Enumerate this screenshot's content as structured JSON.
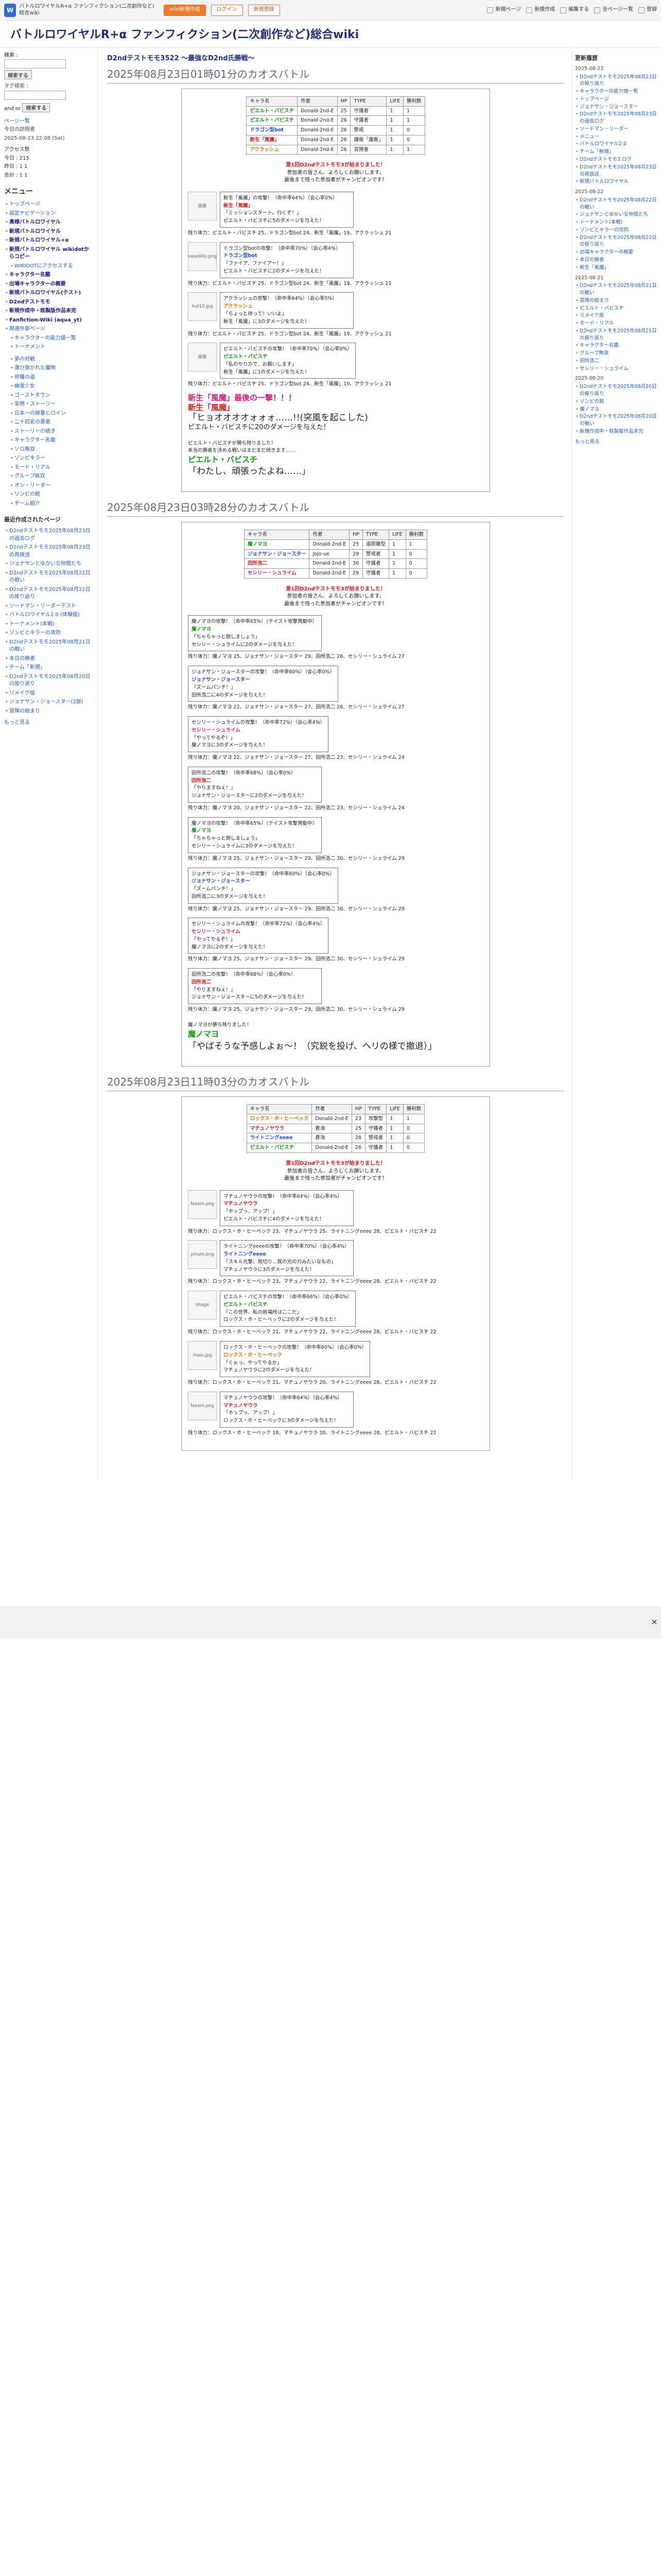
{
  "topbar": {
    "logo_text": "バトルロワイヤルR+α ファンフィクション(二次創作など)総合wiki",
    "logo_letter": "W",
    "buttons": [
      "wiki新規作成",
      "ログイン",
      "新規登録"
    ],
    "links": [
      "新規ページ",
      "新規作成",
      "編集する",
      "全ページ一覧",
      "登録"
    ]
  },
  "header": {
    "title": "バトルロワイヤルR+α ファンフィクション(二次創作など)総合wiki"
  },
  "menubar": {
    "search_label": "検索 :",
    "search_button": "検索する",
    "search2_button": "検索する",
    "tag_label": "タグ検索 :",
    "and_or": "and or",
    "stats": [
      "ページ一覧",
      "今日の訪問者",
      "2025-08-23 22:08 (Sat)"
    ],
    "counts": [
      "アクセス数",
      "今日 : 215",
      "昨日 : 1 1",
      "合計 : 1 1"
    ],
    "menu_title": "メニュー",
    "items": [
      {
        "label": "トップページ",
        "cls": ""
      },
      {
        "label": "設定ナビゲーション",
        "cls": ""
      },
      {
        "label": "奥様バトルロワイヤル",
        "cls": "bold"
      },
      {
        "label": "新規バトルロワイヤル",
        "cls": "bold"
      },
      {
        "label": "新規バトルロワイヤル+α",
        "cls": "bold"
      },
      {
        "label": "新規バトルロワイヤル wikidotからコピー",
        "cls": "bold"
      },
      {
        "label": "WIKIDOTにアクセスする",
        "cls": "sub"
      },
      {
        "label": "キャラクター名鑑",
        "cls": "bold"
      },
      {
        "label": "出場キャラクターの概要",
        "cls": "bold"
      },
      {
        "label": "新規バトルロワイヤル(テスト)",
        "cls": "bold"
      },
      {
        "label": "D2ndテストモモ",
        "cls": "bold"
      },
      {
        "label": "新規作成中・既製版作品未完",
        "cls": "bold"
      },
      {
        "label": "Fanfiction-Wiki (aqua_yt)",
        "cls": "bold"
      },
      {
        "label": "関連外部ページ",
        "cls": ""
      },
      {
        "label": "キャラクターの能力値一覧",
        "cls": "sub"
      },
      {
        "label": "トーナメント",
        "cls": "sub"
      }
    ],
    "items2_title": "",
    "items2": [
      "夢の対戦",
      "選び抜かれた魔物",
      "修羅の道",
      "幽霊少女",
      "ゴーストタウン",
      "妄想・ストーリー",
      "日本一の極悪ヒロイン",
      "二十四名の勇者",
      "ストーリーの続き",
      "キャラクター名鑑",
      "ソロ無双",
      "ゾンビキラー",
      "モード・リアル",
      "グループ無双",
      "オン・リーダー",
      "ゾンビの館",
      "チーム紹介"
    ],
    "recent_title": "最近作成されたページ",
    "recent": [
      "D2ndテストモモ2025年08月23日の過去ログ",
      "D2ndテストモモ2025年08月23日の再放送",
      "ジョナサンとゆかいな仲間たち",
      "D2ndテストモモ2025年08月22日の戦い",
      "D2ndテストモモ2025年08月22日の振り返り",
      "ソードマン・リーダーテスト",
      "バトルロワイヤル2.0 (体験版)",
      "トーナメント(本戦)",
      "ゾンビとキラーの攻防",
      "D2ndテストモモ2025年08月21日の戦い",
      "本日の勝者",
      "チーム「新規」",
      "D2ndテストモモ2025年08月20日の振り返り",
      "リメイク版",
      "ジョナサン・ジョースター(2部)",
      "冒険の始まり"
    ],
    "more_link": "もっと見る"
  },
  "main": {
    "section_title": "D2ndテストモモ3522 ～最強なD2nd氏勝戦～",
    "chapters": [
      {
        "heading": "2025年08月23日01時01分のカオスバトル",
        "roster_headers": [
          "キャラ名",
          "作者",
          "HP",
          "TYPE",
          "LIFE",
          "勝利数"
        ],
        "roster": [
          [
            "ピエルト・バビスチ",
            "Donald-2nd-E",
            "25",
            "守護者",
            "1",
            "1"
          ],
          [
            "ピエルト・バビスチ",
            "Donald-2nd-E",
            "26",
            "守護者",
            "1",
            "1"
          ],
          [
            "ドラゴン型bot",
            "Donald-2nd-E",
            "26",
            "警戒",
            "1",
            "0"
          ],
          [
            "新生「風魔」",
            "Donald-2nd-E",
            "26",
            "護衛「護衛」",
            "1",
            "0"
          ],
          [
            "アクラッシュ",
            "Donald-2nd-E",
            "26",
            "冒険者",
            "1",
            "1"
          ]
        ],
        "intro": [
          "第1回D2ndテストモモ3が始まりました！",
          "参加者の皆さん、よろしくお願いします。",
          "最後まで残った参加者がチャンピオンです！"
        ],
        "status": "残り体力：ピエルト・バビスチ 25、ドラゴン型bot 24、新生「風魔」19、アクラッシュ 21",
        "events": [
          {
            "icon": "画像",
            "lines": [
              "新生「風魔」の攻撃！（命中率64%）（会心率0%）",
              "新生「風魔」",
              "「ミッションスタート。行くぞ！」",
              "ピエルト・バビスチに5のダメージを与えた！"
            ]
          },
          {
            "icon": "vaseikko.png",
            "lines": [
              "ドラゴン型botの攻撃！（命中率70%）（会心率4%）",
              "ドラゴン型bot",
              "「ファイア、ファイアー！」",
              "ピエルト・バビスチに2のダメージを与えた！"
            ]
          },
          {
            "icon": "hut10.jpg",
            "lines": [
              "アクラッシュの攻撃！（命中率64%）（会心率5%）",
              "アクラッシュ",
              "「ちょっと待って！いいよ」",
              "新生「風魔」に3のダメージを与えた！"
            ]
          },
          {
            "icon": "画像",
            "lines": [
              "ピエルト・バビスチの攻撃！（命中率70%）（会心率0%）",
              "ピエルト・バビスチ",
              "「私のやり方で、お願いします」",
              "新生「風魔」に1のダメージを与えた！"
            ]
          }
        ],
        "big_lines": [
          "新生「風魔」最後の一撃！！！",
          "新生「風魔」",
          "「ヒョオオオオォォォ……!!(突風を起こした)",
          "ピエルト・バビスチに20のダメージを与えた！"
        ],
        "finale": {
          "small": "ピエルト・バビスチが勝ち残りました！",
          "note": "本当の勝者を決める戦いはまだまだ続きます……",
          "name": "ピエルト・バビスチ",
          "quote": "「わたし、頑張ったよね……」"
        }
      },
      {
        "heading": "2025年08月23日03時28分のカオスバトル",
        "roster_headers": [
          "キャラ名",
          "作者",
          "HP",
          "TYPE",
          "LIFE",
          "勝利数"
        ],
        "roster": [
          [
            "魔ノマヨ",
            "Donald-2nd-E",
            "25",
            "遠距離型",
            "1",
            "1"
          ],
          [
            "ジョナサン・ジョースター",
            "Jojo-ue",
            "29",
            "警戒者",
            "1",
            "0"
          ],
          [
            "田所浩二",
            "Donald-2nd-E",
            "30",
            "守護者",
            "1",
            "0"
          ],
          [
            "セシリー・シュライム",
            "Donald-2nd-E",
            "29",
            "守護者",
            "1",
            "0"
          ]
        ],
        "intro": [
          "第1回D2ndテストモモ3が始まりました！",
          "参加者の皆さん、よろしくお願いします。",
          "最後まで残った参加者がチャンピオンです！"
        ],
        "status": "残り体力：魔ノマヨ 25、ジョナサン・ジョースター 29、田所浩二 30、セシリー・シュライム 29",
        "events": [
          {
            "icon": "",
            "lines": [
              "魔ノマヨの攻撃！（命中率65%）（テイスト攻撃発動中）",
              "魔ノマヨ",
              "「ちゃちゃっと倒しましょう」",
              "セシリー・シュライムに2のダメージを与えた！"
            ]
          },
          {
            "icon": "",
            "lines": [
              "ジョナサン・ジョースターの攻撃！（命中率60%）（会心率0%）",
              "ジョナサン・ジョースター",
              "「ズームパンチ！」",
              "田所浩二に4のダメージを与えた！"
            ]
          },
          {
            "icon": "",
            "lines": [
              "セシリー・シュライムの攻撃！（命中率72%）（会心率4%）",
              "セシリー・シュライム",
              "「やってやるぞ！」",
              "魔ノマヨに3のダメージを与えた！"
            ]
          },
          {
            "icon": "",
            "lines": [
              "田所浩二の攻撃！（命中率68%）（会心率0%）",
              "田所浩二",
              "「やりますねぇ！」",
              "ジョナサン・ジョースターに2のダメージを与えた！"
            ]
          },
          {
            "icon": "",
            "lines": [
              "魔ノマヨの攻撃！（命中率65%）（テイスト攻撃発動中）",
              "魔ノマヨ",
              "「ちゃちゃっと倒しましょう」",
              "セシリー・シュライムに3のダメージを与えた！"
            ]
          },
          {
            "icon": "",
            "lines": [
              "ジョナサン・ジョースターの攻撃！（命中率60%）（会心率0%）",
              "ジョナサン・ジョースター",
              "「ズームパンチ！」",
              "田所浩二に3のダメージを与えた！"
            ]
          },
          {
            "icon": "",
            "lines": [
              "セシリー・シュライムの攻撃！（命中率72%）（会心率4%）",
              "セシリー・シュライム",
              "「やってやるぞ！」",
              "魔ノマヨに2のダメージを与えた！"
            ]
          },
          {
            "icon": "",
            "lines": [
              "田所浩二の攻撃！（命中率68%）（会心率0%）",
              "田所浩二",
              "「やりますねぇ！」",
              "ジョナサン・ジョースターに5のダメージを与えた！"
            ]
          }
        ],
        "status_lines": [
          "残り体力：魔ノマヨ 25、ジョナサン・ジョースター 29、田所浩二 26、セシリー・シュライム 27",
          "残り体力：魔ノマヨ 22、ジョナサン・ジョースター 27、田所浩二 26、セシリー・シュライム 27",
          "残り体力：魔ノマヨ 22、ジョナサン・ジョースター 27、田所浩二 23、セシリー・シュライム 24",
          "残り体力：魔ノマヨ 20、ジョナサン・ジョースター 22、田所浩二 23、セシリー・シュライム 24"
        ],
        "finale": {
          "small": "魔ノマヨが勝ち残りました！",
          "note": "",
          "name": "魔ノマヨ",
          "quote": "「やばそうな予感しよぉ～！（究鋭を投げ、ヘリの様で撤退）」"
        }
      },
      {
        "heading": "2025年08月23日11時03分のカオスバトル",
        "roster_headers": [
          "キャラ名",
          "作者",
          "HP",
          "TYPE",
          "LIFE",
          "勝利数"
        ],
        "roster": [
          [
            "ロックス・ホ・ヒーベック",
            "Donald-2nd-E",
            "23",
            "攻撃型",
            "1",
            "1"
          ],
          [
            "マチュノヤウラ",
            "蒼海",
            "25",
            "守護者",
            "1",
            "0"
          ],
          [
            "ライトニングeeee",
            "蒼海",
            "28",
            "警戒者",
            "1",
            "0"
          ],
          [
            "ピエルト・バビスチ",
            "Donald-2nd-E",
            "26",
            "守護者",
            "1",
            "0"
          ]
        ],
        "intro": [
          "第1回D2ndテストモモ3が始まりました！",
          "参加者の皆さん、よろしくお願いします。",
          "最後まで残った参加者がチャンピオンです！"
        ],
        "status": "残り体力：ロックス・ホ・ヒーベック 23、マチュノヤウラ 25、ライトニングeeee 28、ピエルト・バビスチ 26",
        "events": [
          {
            "icon": "faeem.png",
            "lines": [
              "マチュノヤウラの攻撃！（命中率64%）（会心率4%）",
              "マチュノヤウラ",
              "「ホップっ、アップ！」",
              "ピエルト・バビスチに4のダメージを与えた！"
            ]
          },
          {
            "icon": "yinum.png",
            "lines": [
              "ライトニングeeeeの攻撃！（命中率70%）（会心率4%）",
              "ライトニングeeee",
              "「スキル光撃、見切り…我の光の力みたいなもの」",
              "マチュノヤウラに3のダメージを与えた！"
            ]
          },
          {
            "icon": "image",
            "lines": [
              "ピエルト・バビスチの攻撃！（命中率66%）（会心率0%）",
              "ピエルト・バビスチ",
              "「この世界、私の居場所はここだ」",
              "ロックス・ホ・ヒーベックに2のダメージを与えた！"
            ]
          },
          {
            "icon": "main.jpg",
            "lines": [
              "ロックス・ホ・ヒーベックの攻撃！（命中率60%）（会心率0%）",
              "ロックス・ホ・ヒーベック",
              "「ぐぉっ、やってやるか」",
              "マチュノヤウラに2のダメージを与えた！"
            ]
          },
          {
            "icon": "faeem.png",
            "lines": [
              "マチュノヤウラの攻撃！（命中率64%）（会心率4%）",
              "マチュノヤウラ",
              "「ホップっ、アップ！」",
              "ロックス・ホ・ヒーベックに3のダメージを与えた！"
            ]
          }
        ],
        "status_lines": [
          "残り体力：ロックス・ホ・ヒーベック 23、マチュノヤウラ 25、ライトニングeeee 28、ピエルト・バビスチ 22",
          "残り体力：ロックス・ホ・ヒーベック 23、マチュノヤウラ 22、ライトニングeeee 28、ピエルト・バビスチ 22",
          "残り体力：ロックス・ホ・ヒーベック 21、マチュノヤウラ 22、ライトニングeeee 28、ピエルト・バビスチ 22",
          "残り体力：ロックス・ホ・ヒーベック 21、マチュノヤウラ 20、ライトニングeeee 28、ピエルト・バビスチ 22",
          "残り体力：ロックス・ホ・ヒーベック 18、マチュノヤウラ 20、ライトニングeeee 28、ピエルト・バビスチ 22"
        ]
      }
    ]
  },
  "rightbar": {
    "title": "更新履歴",
    "groups": [
      {
        "date": "2025-08-23",
        "items": [
          "D2ndテストモモ2025年08月23日の振り返り",
          "キャラクターの能力値一覧",
          "トップページ",
          "ジョナサン・ジョースター",
          "D2ndテストモモ2025年08月23日の過去ログ",
          "ソードマン・リーダー",
          "メニュー",
          "バトルロワイヤル2.0",
          "チーム「新規」",
          "D2ndテストモモ3 ログ",
          "D2ndテストモモ2025年08月23日の再放送",
          "新規バトルロワイヤル"
        ]
      },
      {
        "date": "2025-08-22",
        "items": [
          "D2ndテストモモ2025年08月22日の戦い",
          "ジョナサンとゆかいな仲間たち",
          "トーナメント(本戦)",
          "ゾンビとキラーの攻防",
          "D2ndテストモモ2025年08月22日の振り返り",
          "出場キャラクターの概要",
          "本日の勝者",
          "新生「風魔」"
        ]
      },
      {
        "date": "2025-08-21",
        "items": [
          "D2ndテストモモ2025年08月21日の戦い",
          "冒険の始まり",
          "ピエルト・バビスチ",
          "リメイク版",
          "モード・リアル",
          "D2ndテストモモ2025年08月21日の振り返り",
          "キャラクター名鑑",
          "グループ無双",
          "田所浩二",
          "セシリー・シュライム"
        ]
      },
      {
        "date": "2025-08-20",
        "items": [
          "D2ndテストモモ2025年08月20日の振り返り",
          "ゾンビの館",
          "魔ノマヨ",
          "D2ndテストモモ2025年08月20日の戦い",
          "新規作成中・既製版作品未完"
        ]
      }
    ],
    "more": "もっと見る"
  }
}
